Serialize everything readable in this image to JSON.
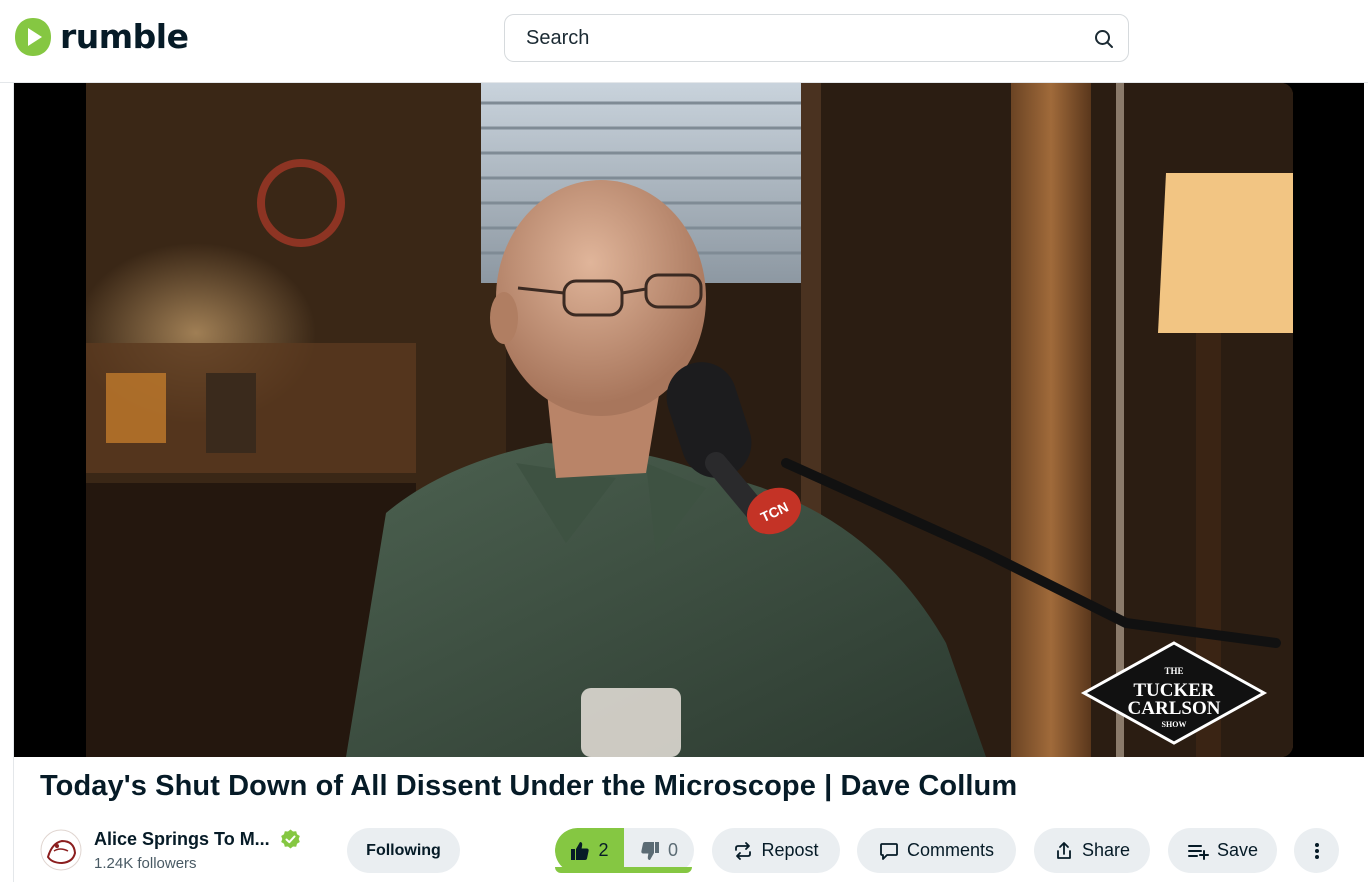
{
  "header": {
    "logo_text": "rumble",
    "search_placeholder": "Search"
  },
  "video": {
    "watermark_line1": "THE",
    "watermark_line2": "TUCKER",
    "watermark_line3": "CARLSON",
    "watermark_line4": "SHOW",
    "mic_badge": "TCN"
  },
  "title": "Today's Shut Down of All Dissent Under the Microscope | Dave Collum",
  "channel": {
    "name": "Alice Springs To M...",
    "followers": "1.24K followers",
    "verified_icon": "verified-check-icon"
  },
  "actions": {
    "following_label": "Following",
    "likes": "2",
    "dislikes": "0",
    "like_ratio": 1.0,
    "repost_label": "Repost",
    "comments_label": "Comments",
    "share_label": "Share",
    "save_label": "Save"
  },
  "colors": {
    "brand_green": "#85c742",
    "text_dark": "#061b27",
    "pill_bg": "#eaeef1"
  }
}
